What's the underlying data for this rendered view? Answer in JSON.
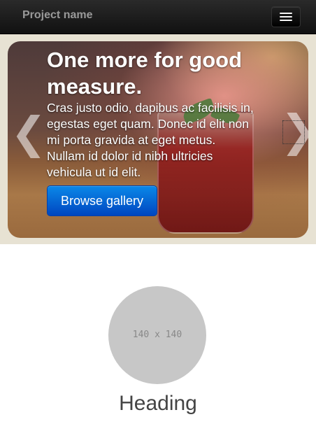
{
  "navbar": {
    "brand": "Project name",
    "menu_icon": "menu-icon"
  },
  "carousel": {
    "title": "One more for good measure.",
    "text": "Cras justo odio, dapibus ac facilisis in, egestas eget quam. Donec id elit non mi porta gravida at eget metus. Nullam id dolor id nibh ultricies vehicula ut id elit.",
    "button_label": "Browse gallery",
    "prev_glyph": "❮",
    "next_glyph": "❯",
    "button_color": "#0a6fd8"
  },
  "feature": {
    "placeholder_label": "140 x 140",
    "heading": "Heading"
  }
}
